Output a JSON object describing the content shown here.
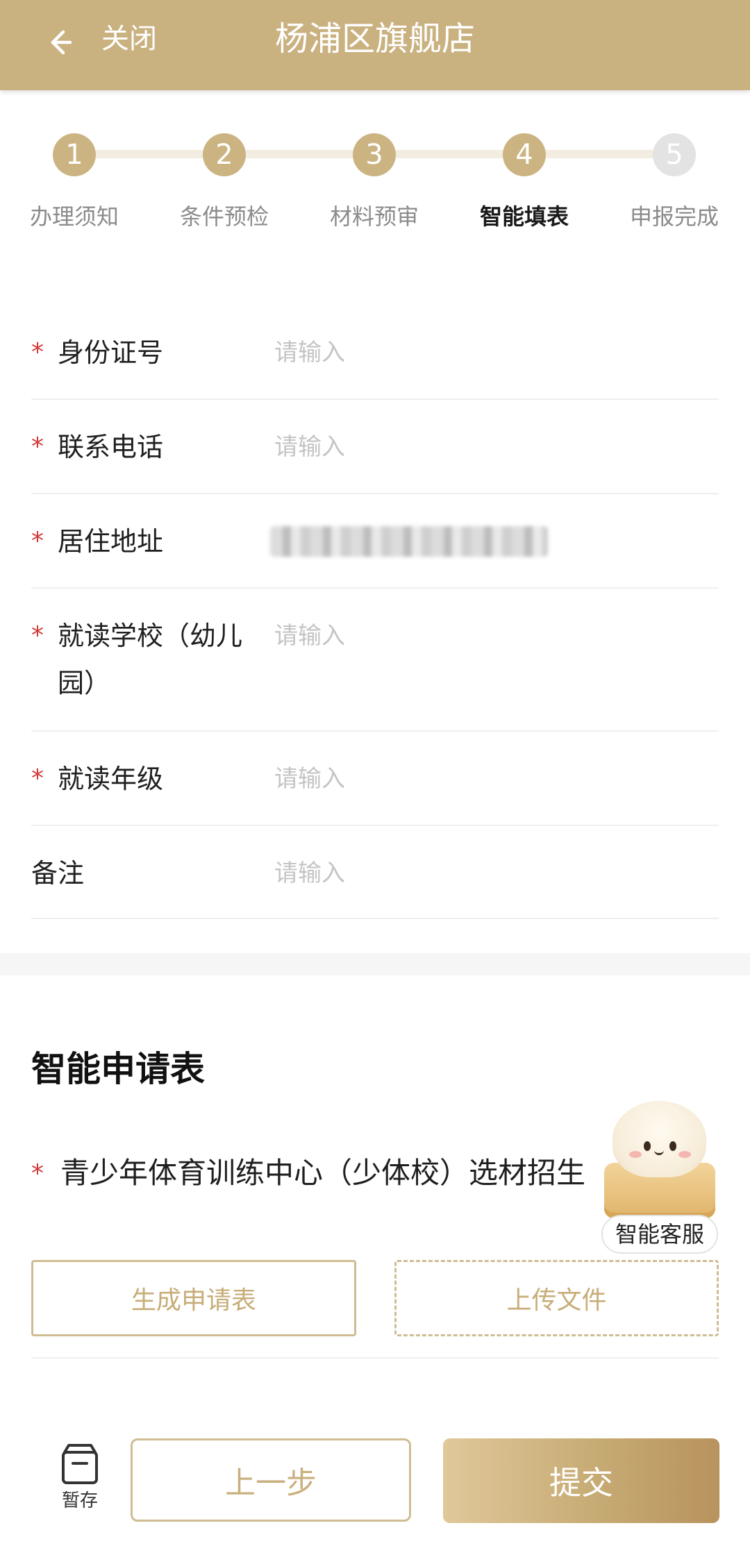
{
  "header": {
    "close_label": "关闭",
    "title": "杨浦区旗舰店",
    "background": "#c9b180"
  },
  "stepper": {
    "current": 4,
    "steps": [
      {
        "number": "1",
        "label": "办理须知",
        "state": "done"
      },
      {
        "number": "2",
        "label": "条件预检",
        "state": "done"
      },
      {
        "number": "3",
        "label": "材料预审",
        "state": "done"
      },
      {
        "number": "4",
        "label": "智能填表",
        "state": "active"
      },
      {
        "number": "5",
        "label": "申报完成",
        "state": "pending"
      }
    ]
  },
  "form": {
    "fields": [
      {
        "label": "身份证号",
        "required": true,
        "placeholder": "请输入",
        "value": ""
      },
      {
        "label": "联系电话",
        "required": true,
        "placeholder": "请输入",
        "value": ""
      },
      {
        "label": "居住地址",
        "required": true,
        "placeholder": "",
        "value": "(blurred)"
      },
      {
        "label": "就读学校（幼儿园）",
        "required": true,
        "placeholder": "请输入",
        "value": ""
      },
      {
        "label": "就读年级",
        "required": true,
        "placeholder": "请输入",
        "value": ""
      },
      {
        "label": "备注",
        "required": false,
        "placeholder": "请输入",
        "value": ""
      }
    ],
    "required_mark": "*"
  },
  "application": {
    "section_title": "智能申请表",
    "doc_name": "青少年体育训练中心（少体校）选材招生",
    "generate_label": "生成申请表",
    "upload_label": "上传文件"
  },
  "assistant": {
    "label": "智能客服"
  },
  "bottom_bar": {
    "save_label": "暂存",
    "prev_label": "上一步",
    "submit_label": "提交"
  },
  "colors": {
    "accent": "#c9b180",
    "required": "#d13a3a",
    "pending_step": "#e3e3e3"
  }
}
